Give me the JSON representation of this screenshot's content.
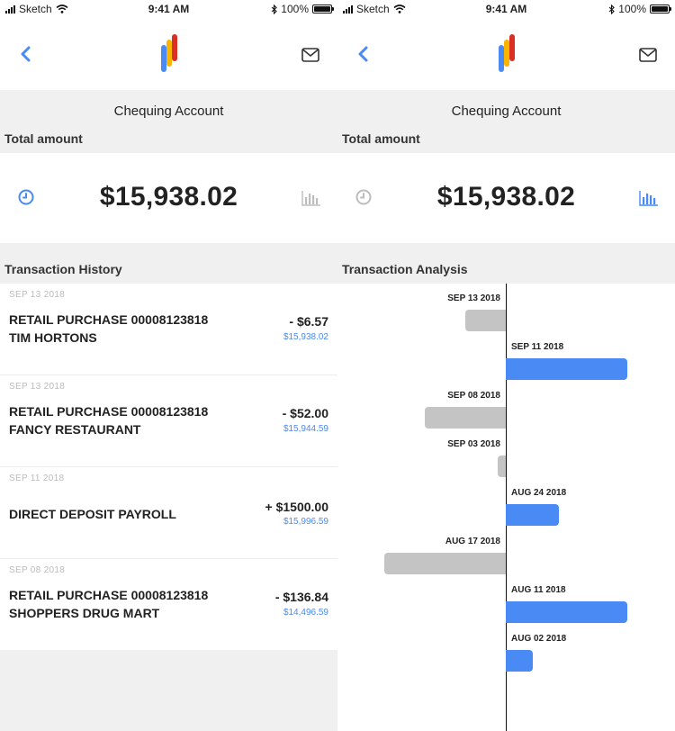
{
  "status_bar": {
    "carrier": "Sketch",
    "time": "9:41 AM",
    "battery": "100%"
  },
  "account": {
    "title": "Chequing Account",
    "total_label": "Total amount",
    "total_amount": "$15,938.02"
  },
  "history": {
    "title": "Transaction History",
    "items": [
      {
        "date": "SEP 13 2018",
        "desc_line1": "RETAIL PURCHASE 00008123818",
        "desc_line2": "TIM HORTONS",
        "amount": "- $6.57",
        "balance": "$15,938.02"
      },
      {
        "date": "SEP 13 2018",
        "desc_line1": "RETAIL PURCHASE 00008123818",
        "desc_line2": "FANCY RESTAURANT",
        "amount": "- $52.00",
        "balance": "$15,944.59"
      },
      {
        "date": "SEP 11 2018",
        "desc_line1": "DIRECT DEPOSIT PAYROLL",
        "desc_line2": "",
        "amount": "+ $1500.00",
        "balance": "$15,996.59"
      },
      {
        "date": "SEP 08 2018",
        "desc_line1": "RETAIL PURCHASE 00008123818",
        "desc_line2": "SHOPPERS DRUG MART",
        "amount": "- $136.84",
        "balance": "$14,496.59"
      }
    ]
  },
  "analysis": {
    "title": "Transaction Analysis",
    "bars": [
      {
        "date": "SEP 13 2018",
        "direction": "out",
        "relative_size": 0.33
      },
      {
        "date": "SEP 11 2018",
        "direction": "in",
        "relative_size": 1.0
      },
      {
        "date": "SEP 08 2018",
        "direction": "out",
        "relative_size": 0.67
      },
      {
        "date": "SEP 03 2018",
        "direction": "out",
        "relative_size": 0.07
      },
      {
        "date": "AUG 24 2018",
        "direction": "in",
        "relative_size": 0.44
      },
      {
        "date": "AUG 17 2018",
        "direction": "out",
        "relative_size": 1.0
      },
      {
        "date": "AUG 11 2018",
        "direction": "in",
        "relative_size": 1.0
      },
      {
        "date": "AUG 02 2018",
        "direction": "in",
        "relative_size": 0.22
      }
    ]
  },
  "icons": {
    "back": "chevron-left-icon",
    "logo": "app-logo",
    "mail": "envelope-icon",
    "clock": "clock-icon",
    "chart": "bar-chart-icon"
  },
  "colors": {
    "accent_blue": "#4a8af4",
    "outflow_gray": "#c4c4c4",
    "inactive_icon_gray": "#bdbdbd",
    "logo_red": "#d93025",
    "logo_yellow": "#f9b400",
    "logo_blue": "#4a8af4"
  }
}
